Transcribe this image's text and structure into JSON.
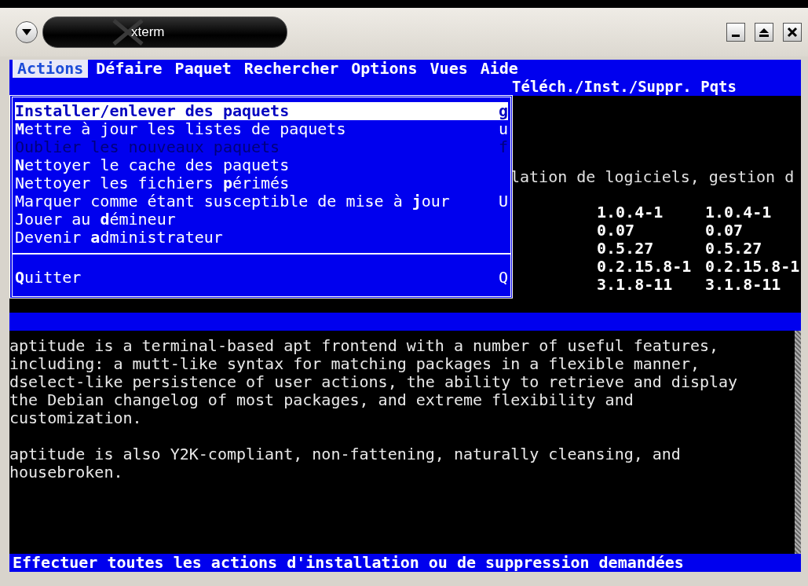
{
  "window": {
    "title": "xterm"
  },
  "menubar": [
    {
      "label": "Actions",
      "selected": true
    },
    {
      "label": "Défaire",
      "selected": false
    },
    {
      "label": "Paquet",
      "selected": false
    },
    {
      "label": "Rechercher",
      "selected": false
    },
    {
      "label": "Options",
      "selected": false
    },
    {
      "label": "Vues",
      "selected": false
    },
    {
      "label": "Aide",
      "selected": false
    }
  ],
  "header": {
    "title": "Téléch./Inst./Suppr. Pqts"
  },
  "package_pane": {
    "description_line": "lation de logiciels, gestion d",
    "versions": [
      {
        "current": "1.0.4-1",
        "candidate": "1.0.4-1"
      },
      {
        "current": "0.07",
        "candidate": "0.07"
      },
      {
        "current": "0.5.27",
        "candidate": "0.5.27"
      },
      {
        "current": "0.2.15.8-1",
        "candidate": "0.2.15.8-1"
      },
      {
        "current": "3.1.8-11",
        "candidate": "3.1.8-11"
      }
    ]
  },
  "menu": {
    "items": [
      {
        "kind": "item",
        "label": "Installer/enlever des paquets",
        "shortcut": "g",
        "selected": true,
        "disabled": false
      },
      {
        "kind": "item",
        "label": "**M**ettre à jour les listes de paquets",
        "shortcut": "u",
        "selected": false,
        "disabled": false
      },
      {
        "kind": "item",
        "label": "Oublier les nouveaux paquets",
        "shortcut": "f",
        "selected": false,
        "disabled": true
      },
      {
        "kind": "item",
        "label": "**N**ettoyer le cache des paquets",
        "selected": false,
        "disabled": false
      },
      {
        "kind": "item",
        "label": "Nettoyer les fichiers **p**érimés",
        "selected": false,
        "disabled": false
      },
      {
        "kind": "item",
        "label": "Marquer comme étant susceptible de mise à **j**our",
        "shortcut": "U",
        "selected": false,
        "disabled": false
      },
      {
        "kind": "item",
        "label": "Jouer au **d**émineur",
        "selected": false,
        "disabled": false
      },
      {
        "kind": "item",
        "label": "Devenir **a**dministrateur",
        "selected": false,
        "disabled": false
      },
      {
        "kind": "separator"
      },
      {
        "kind": "item",
        "label": "**Q**uitter",
        "shortcut": "Q",
        "selected": false,
        "disabled": false
      }
    ]
  },
  "description": {
    "paragraphs": [
      "aptitude is a terminal-based apt frontend with a number of useful features,\nincluding: a mutt-like syntax for matching packages in a flexible manner,\ndselect-like persistence of user actions, the ability to retrieve and display\nthe Debian changelog of most packages, and extreme flexibility and\ncustomization.",
      "aptitude is also Y2K-compliant, non-fattening, naturally cleansing, and\nhousebroken."
    ]
  },
  "status_bar": {
    "text": "Effectuer toutes les actions d'installation ou de suppression demandées"
  }
}
